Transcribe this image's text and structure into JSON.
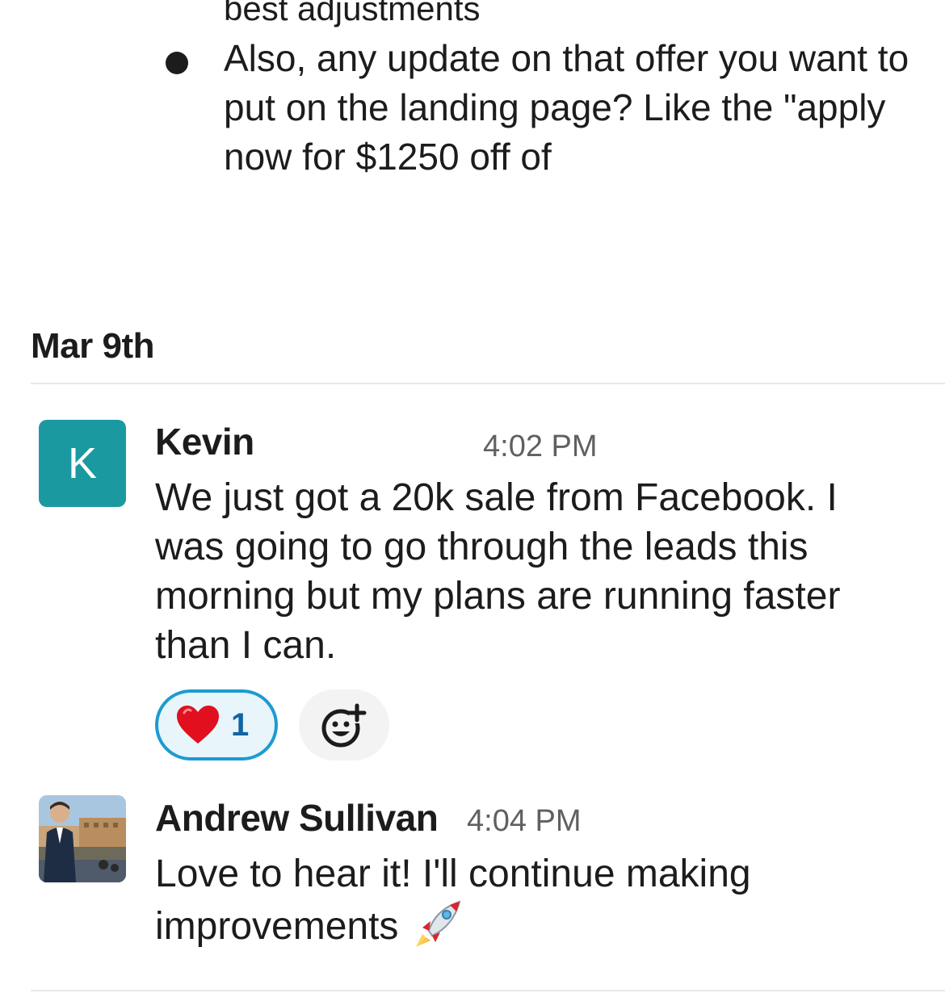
{
  "previous_message": {
    "partial_line": "best adjustments",
    "bullet_text": "Also, any update on that offer you want to put on the landing page? Like the \"apply now for $1250 off of"
  },
  "date_divider": {
    "label": "Mar 9th"
  },
  "messages": [
    {
      "avatar_initial": "K",
      "avatar_color": "#1a9aa0",
      "sender": "Kevin",
      "time": "4:02 PM",
      "text": "We just got a 20k sale from Facebook.  I was going to go through the leads this morning but my plans are running faster than I can.",
      "reactions": [
        {
          "emoji": "❤️",
          "icon": "heart-emoji",
          "count": "1",
          "selected": true
        }
      ]
    },
    {
      "avatar": "photo",
      "sender": "Andrew Sullivan",
      "time": "4:04 PM",
      "text": "Love to hear it! I'll continue making improvements",
      "trailing_emoji": "rocket-emoji"
    }
  ],
  "colors": {
    "reaction_border": "#1d9bd1",
    "reaction_bg": "#e8f5fa",
    "reaction_count": "#1264a3"
  }
}
